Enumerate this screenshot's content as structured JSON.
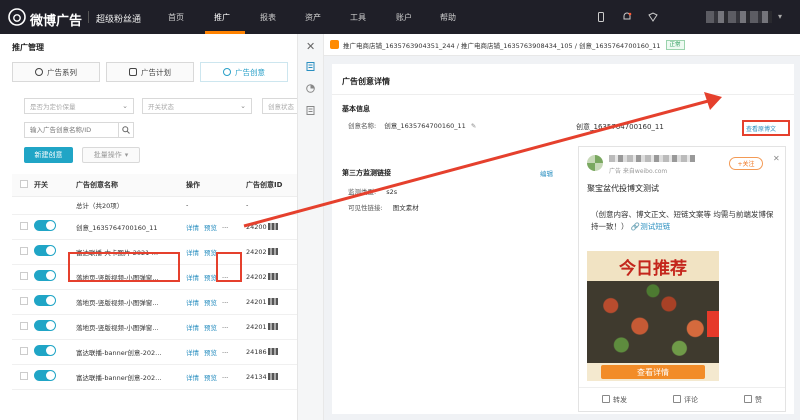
{
  "topbar": {
    "logo_text": "微博广告",
    "product": "超级粉丝通",
    "nav": [
      "首页",
      "推广",
      "报表",
      "资产",
      "工具",
      "账户",
      "帮助"
    ],
    "active_nav": "推广"
  },
  "left": {
    "page_title": "推广管理",
    "tabs": [
      "广告系列",
      "广告计划",
      "广告创意"
    ],
    "active_tab": "广告创意",
    "filters": {
      "bid_placeholder": "是否为定价保量",
      "switch_placeholder": "开关状态",
      "status_placeholder": "创意状态",
      "search_placeholder": "输入广告创意名称/ID"
    },
    "new_button": "新建创意",
    "batch_button": "批量操作",
    "table": {
      "headers": [
        "开关",
        "广告创意名称",
        "操作",
        "广告创意ID"
      ],
      "total_label": "总计（共20项）",
      "total_ops": "-",
      "total_id": "-",
      "rows": [
        {
          "name": "创意_1635764700160_11",
          "detail": "详情",
          "preview": "预览",
          "id": "24200"
        },
        {
          "name": "富达联播-大卡图片-2021-…",
          "detail": "详情",
          "preview": "预览",
          "id": "24202"
        },
        {
          "name": "落地页-竖版视频-小图弹窗…",
          "detail": "详情",
          "preview": "预览",
          "id": "24202"
        },
        {
          "name": "落地页-竖版视频-小图弹窗…",
          "detail": "详情",
          "preview": "预览",
          "id": "24201"
        },
        {
          "name": "落地页-竖版视频-小图弹窗…",
          "detail": "详情",
          "preview": "预览",
          "id": "24201"
        },
        {
          "name": "富达联播-banner创意-202…",
          "detail": "详情",
          "preview": "预览",
          "id": "24186"
        },
        {
          "name": "富达联播-banner创意-202…",
          "detail": "详情",
          "preview": "预览",
          "id": "24134"
        }
      ]
    }
  },
  "drawer": {
    "breadcrumb": "推广电商店铺_1635763904351_244 / 推广电商店铺_1635763908434_105 / 创意_1635764700160_11",
    "status_badge": "正常",
    "card_title": "广告创意详情",
    "basic_section": "基本信息",
    "creative_name_label": "创意名称:",
    "creative_name_value": "创意_1635764700160_11",
    "tracking_section": "第三方监测链接",
    "config_link": "编辑",
    "monitor_type_label": "监测类型:",
    "monitor_type_value": "s2s",
    "visible_label": "可见性链接:",
    "visible_value": "图文素材",
    "preview_name": "创意_1635764700160_11",
    "preview_link": "查看原博文"
  },
  "post": {
    "source": "广告 来自weibo.com",
    "follow": "+关注",
    "title": "聚宝盆代投博文测试",
    "body": "（创意内容、博文正文、短链文案等 均需与前端发博保持一致！）",
    "body_link": "测试短链",
    "banner": "今日推荐",
    "cta": "查看详情",
    "actions": [
      "转发",
      "评论",
      "赞"
    ]
  },
  "colors": {
    "accent": "#20a5c6",
    "brand_orange": "#ff8200",
    "highlight": "#e5402d"
  }
}
